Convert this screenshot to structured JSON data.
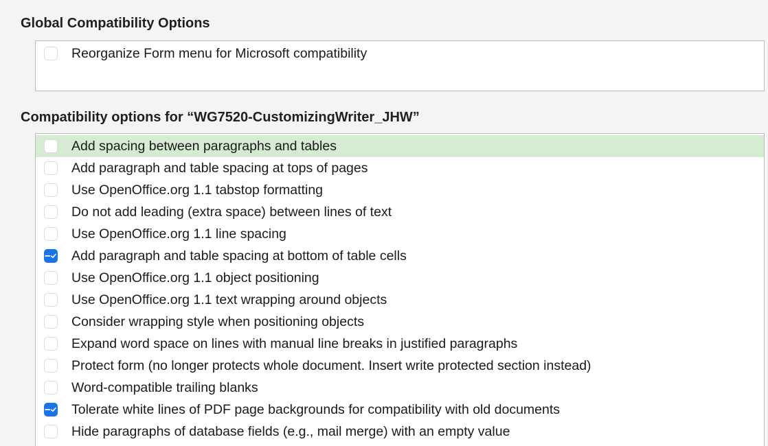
{
  "global_section": {
    "title": "Global Compatibility Options",
    "options": [
      {
        "label": "Reorganize Form menu for Microsoft compatibility",
        "state": "unchecked"
      }
    ]
  },
  "document_section": {
    "title": "Compatibility options for “WG7520-CustomizingWriter_JHW”",
    "options": [
      {
        "label": "Add spacing between paragraphs and tables",
        "state": "unchecked",
        "selected": true
      },
      {
        "label": "Add paragraph and table spacing at tops of pages",
        "state": "unchecked"
      },
      {
        "label": "Use OpenOffice.org 1.1 tabstop formatting",
        "state": "unchecked"
      },
      {
        "label": "Do not add leading (extra space) between lines of text",
        "state": "unchecked"
      },
      {
        "label": "Use OpenOffice.org 1.1 line spacing",
        "state": "unchecked"
      },
      {
        "label": "Add paragraph and table spacing at bottom of table cells",
        "state": "mixed"
      },
      {
        "label": "Use OpenOffice.org 1.1 object positioning",
        "state": "unchecked"
      },
      {
        "label": "Use OpenOffice.org 1.1 text wrapping around objects",
        "state": "unchecked"
      },
      {
        "label": "Consider wrapping style when positioning objects",
        "state": "unchecked"
      },
      {
        "label": "Expand word space on lines with manual line breaks in justified paragraphs",
        "state": "unchecked"
      },
      {
        "label": "Protect form (no longer protects whole document. Insert write protected section instead)",
        "state": "unchecked"
      },
      {
        "label": "Word-compatible trailing blanks",
        "state": "unchecked"
      },
      {
        "label": "Tolerate white lines of PDF page backgrounds for compatibility with old documents",
        "state": "checked"
      },
      {
        "label": "Hide paragraphs of database fields (e.g., mail merge) with an empty value",
        "state": "unchecked"
      }
    ]
  },
  "colors": {
    "accent": "#1a73e8",
    "selected_row": "#d6ecd2",
    "panel_background": "#f4f4f4"
  }
}
